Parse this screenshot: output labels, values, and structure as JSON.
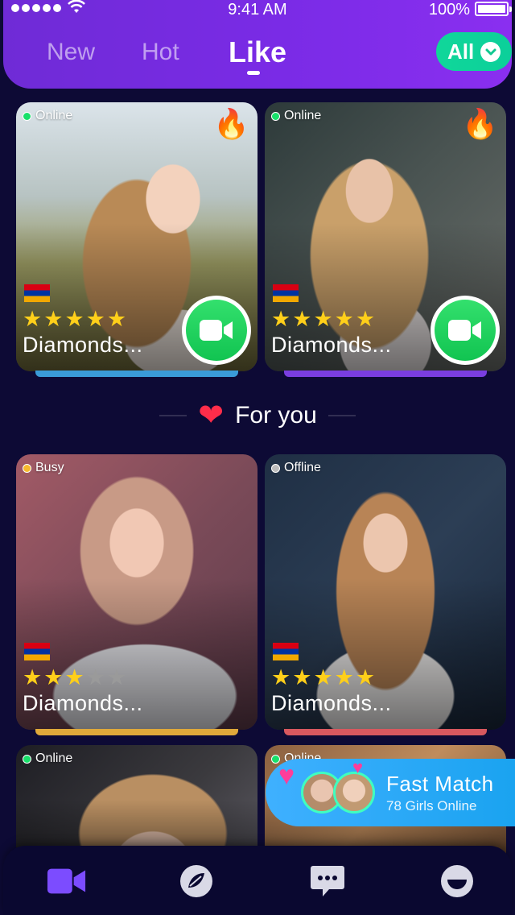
{
  "status_bar": {
    "time": "9:41 AM",
    "battery": "100%"
  },
  "tabs": [
    {
      "label": "New",
      "active": false
    },
    {
      "label": "Hot",
      "active": false
    },
    {
      "label": "Like",
      "active": true
    }
  ],
  "filter": {
    "label": "All"
  },
  "featured": [
    {
      "status": "Online",
      "status_color": "#18e06a",
      "name": "Diamonds...",
      "stars": 5,
      "country_flag": "armenia-flag-icon",
      "hot": true,
      "accent": "#3a9bd8"
    },
    {
      "status": "Online",
      "status_color": "#18e06a",
      "name": "Diamonds...",
      "stars": 5,
      "country_flag": "armenia-flag-icon",
      "hot": true,
      "accent": "#7a3ee0"
    }
  ],
  "for_you": {
    "title": "For you"
  },
  "profiles": [
    {
      "status": "Busy",
      "status_color": "#f7b92e",
      "name": "Diamonds...",
      "stars": 3,
      "country_flag": "armenia-flag-icon",
      "accent": "#e0a93a"
    },
    {
      "status": "Offline",
      "status_color": "#bdbdbd",
      "name": "Diamonds...",
      "stars": 5,
      "country_flag": "armenia-flag-icon",
      "accent": "#d8585f"
    },
    {
      "status": "Online",
      "status_color": "#18e06a"
    },
    {
      "status": "Online",
      "status_color": "#18e06a"
    }
  ],
  "fast_match": {
    "title": "Fast Match",
    "subtitle": "78 Girls Online"
  },
  "bottom_nav": [
    {
      "icon": "video-camera-icon",
      "active": true
    },
    {
      "icon": "discover-icon",
      "active": false
    },
    {
      "icon": "messages-icon",
      "active": false
    },
    {
      "icon": "profile-icon",
      "active": false
    }
  ],
  "colors": {
    "accent": "#7a2be6",
    "background": "#0d0a35",
    "online": "#18e06a",
    "cta": "#10d79a"
  }
}
